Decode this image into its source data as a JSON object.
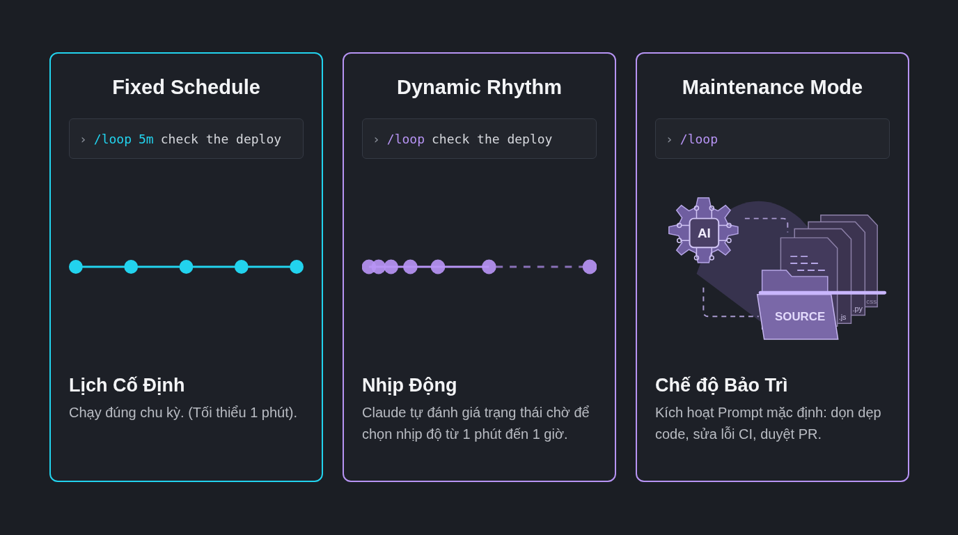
{
  "cards": [
    {
      "title": "Fixed Schedule",
      "color": "#22d3ee",
      "command": {
        "prompt": "›",
        "name": "/loop",
        "args": "5m",
        "text": "check the deploy"
      },
      "visual": {
        "kind": "fixed"
      },
      "heading": "Lịch Cố Định",
      "description": "Chạy đúng chu kỳ. (Tối thiểu 1 phút)."
    },
    {
      "title": "Dynamic Rhythm",
      "color": "#b794f4",
      "command": {
        "prompt": "›",
        "name": "/loop",
        "text": "check the deploy"
      },
      "visual": {
        "kind": "dynamic"
      },
      "heading": "Nhịp Động",
      "description": "Claude tự đánh giá trạng thái chờ để chọn nhịp độ từ 1 phút đến 1 giờ."
    },
    {
      "title": "Maintenance Mode",
      "color": "#b794f4",
      "command": {
        "prompt": "›",
        "name": "/loop"
      },
      "visual": {
        "kind": "illustration",
        "chip": "AI",
        "folder": "SOURCE",
        "files": [
          ".js",
          ".py",
          "css"
        ]
      },
      "heading": "Chế độ Bảo Trì",
      "description": "Kích hoạt Prompt mặc định: dọn dẹp code, sửa lỗi CI, duyệt PR."
    }
  ]
}
